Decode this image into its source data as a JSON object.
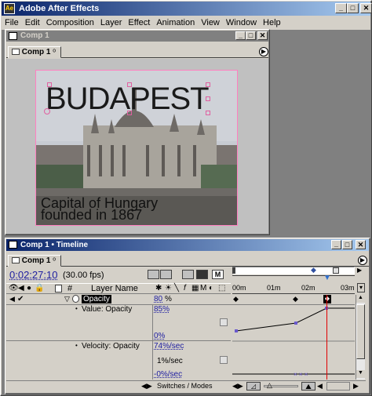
{
  "app": {
    "title": "Adobe After Effects"
  },
  "menu": [
    "File",
    "Edit",
    "Composition",
    "Layer",
    "Effect",
    "Animation",
    "View",
    "Window",
    "Help"
  ],
  "comp_window": {
    "title": "Comp 1",
    "tab": "Comp 1",
    "overlay_title": "BUDAPEST",
    "caption_line1": "Capital of Hungary",
    "caption_line2": "founded in 1867"
  },
  "timeline": {
    "title": "Comp 1 • Timeline",
    "tab": "Comp 1",
    "time": "0:02:27:10",
    "fps": "(30.00 fps)",
    "layer_name_header": "Layer Name",
    "hash_header": "#",
    "ruler": [
      "00m",
      "01m",
      "02m",
      "03m"
    ],
    "property": "Opacity",
    "property_value": "80",
    "property_unit": "%",
    "value_label": "Value: Opacity",
    "value_max": "85%",
    "value_min": "0%",
    "velocity_label": "Velocity: Opacity",
    "velocity_value": "74%/sec",
    "velocity_mid": "1%/sec",
    "velocity_min": "-0%/sec",
    "switches_label": "Switches / Modes"
  },
  "colors": {
    "titlebar": "#0a246a",
    "current_time_line": "#e00000",
    "keyframe_purple": "#6a5acd",
    "time_text": "#2020a0"
  }
}
